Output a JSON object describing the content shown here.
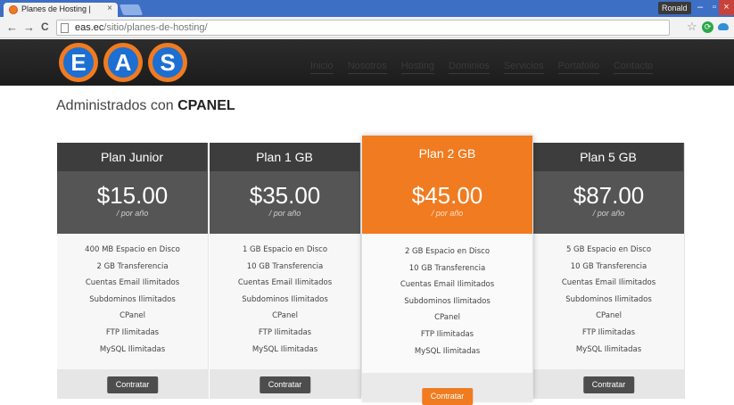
{
  "browser": {
    "tab_title": "Planes de Hosting |",
    "tab_close": "×",
    "user": "Ronald",
    "url_domain": "eas.ec",
    "url_path": "/sitio/planes-de-hosting/",
    "back": "←",
    "forward": "→",
    "reload": "C",
    "star": "☆",
    "min": "–",
    "max": "▫",
    "close": "×"
  },
  "site": {
    "logo_letters": [
      "E",
      "A",
      "S"
    ],
    "nav": [
      "Inicio",
      "Nosotros",
      "Hosting",
      "Dominios",
      "Servicios",
      "Portafolio",
      "Contacto"
    ]
  },
  "section": {
    "heading_prefix": "Administrados con",
    "heading_bold": "CPANEL"
  },
  "plans": [
    {
      "name": "Plan Junior",
      "price": "$15.00",
      "period": "/ por año",
      "features": [
        "400 MB Espacio en Disco",
        "2 GB Transferencia",
        "Cuentas Email Ilimitados",
        "Subdominos Ilimitados",
        "CPanel",
        "FTP Ilimitadas",
        "MySQL Ilimitadas"
      ],
      "button": "Contratar"
    },
    {
      "name": "Plan 1 GB",
      "price": "$35.00",
      "period": "/ por año",
      "features": [
        "1 GB Espacio en Disco",
        "10 GB Transferencia",
        "Cuentas Email Ilimitados",
        "Subdominos Ilimitados",
        "CPanel",
        "FTP Ilimitadas",
        "MySQL Ilimitadas"
      ],
      "button": "Contratar"
    },
    {
      "name": "Plan 2 GB",
      "price": "$45.00",
      "period": "/ por año",
      "features": [
        "2 GB Espacio en Disco",
        "10 GB Transferencia",
        "Cuentas Email Ilimitados",
        "Subdominos Ilimitados",
        "CPanel",
        "FTP Ilimitadas",
        "MySQL Ilimitadas"
      ],
      "button": "Contratar"
    },
    {
      "name": "Plan 5 GB",
      "price": "$87.00",
      "period": "/ por año",
      "features": [
        "5 GB Espacio en Disco",
        "10 GB Transferencia",
        "Cuentas Email Ilimitados",
        "Subdominos Ilimitados",
        "CPanel",
        "FTP Ilimitadas",
        "MySQL Ilimitadas"
      ],
      "button": "Contratar"
    }
  ],
  "colors": {
    "accent": "#f07b20",
    "dark": "#3d3d3d",
    "logo_blue": "#1d6fd1"
  }
}
